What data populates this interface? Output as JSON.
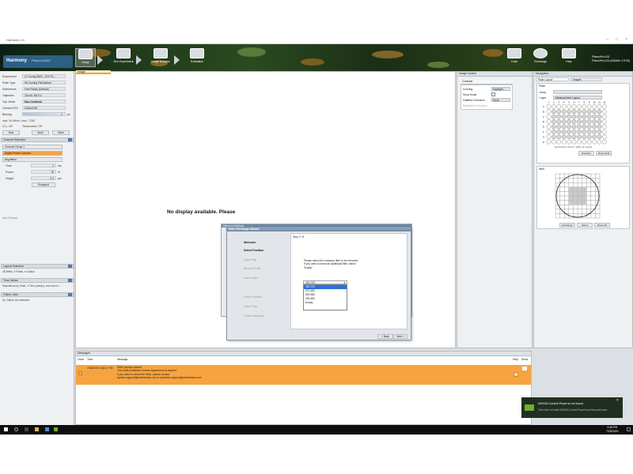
{
  "window": {
    "title": "Harmony 4.9"
  },
  "banner": {
    "logo_text": "Harmony",
    "logo_sub": "PhenoLOGIC",
    "tools": [
      {
        "label": "Setup"
      },
      {
        "label": "Run Experiment"
      },
      {
        "label": "Image Analysis"
      },
      {
        "label": "Evaluation"
      }
    ],
    "right_tools": [
      {
        "label": "Data"
      },
      {
        "label": "Exchange"
      },
      {
        "label": "Help"
      }
    ],
    "user_lines": [
      "PhenixPro123",
      "PhenixPro123 (ADMIN: 2.5TB)"
    ]
  },
  "left": {
    "fields": [
      {
        "key": "Experiment",
        "value": "LF Cornig 3603 - 20X P1..."
      },
      {
        "key": "Plate Type",
        "value": "96 Corning Flat Bottom"
      },
      {
        "key": "Subfluence",
        "value": "Fine Plastic (Default)"
      },
      {
        "key": "Objective",
        "value": "20x Air, NA 0.4"
      },
      {
        "key": "Opt. Mode",
        "value": "Non-Confocal"
      },
      {
        "key": "Camera ROI",
        "value": "2160x2160"
      },
      {
        "key": "Binning",
        "value": "2"
      }
    ],
    "binning_unit": "px",
    "measurement": "max: 3h 26min / max: 7,258",
    "co2": "CO₂: Off",
    "temperature": "Temperature: Off",
    "buttons": [
      "New",
      "Save",
      "Save"
    ],
    "channel_section": "Channel Selection",
    "channel_group": "Channel Group 1",
    "channel_active": "Digital Phase Contrast",
    "channel_bf": "Brightfield",
    "params": [
      {
        "key": "Time",
        "value": "1",
        "unit": "ms"
      },
      {
        "key": "Power",
        "value": "76",
        "unit": "%"
      },
      {
        "key": "Height",
        "value": "-2.0",
        "unit": "µm"
      }
    ],
    "snapshot_label": "Snapshot",
    "add_channel": "Add Channel",
    "layout_section": "Layout Selection",
    "layout_text": "48 Wells, 9 Fields, no Stack",
    "timeseries_section": "Time Series",
    "timeseries_text": "Repetitions by Plate, 1 Time point(s), not used in ...",
    "online_section": "Online Jobs",
    "online_text": "No Online Job selected"
  },
  "center": {
    "tab": "Image",
    "no_display": "No display available. Please"
  },
  "control": {
    "title": "Image Control",
    "section": "Contrast",
    "rows": [
      {
        "key": "Coloring",
        "value": "Highlight"
      },
      {
        "key": "Show Scale",
        "value": ""
      },
      {
        "key": "Flatfield Correction",
        "value": "None"
      },
      {
        "key": "Brightfield Correction",
        "value": ""
      }
    ]
  },
  "nav": {
    "title": "Navigation",
    "tabs": [
      "Plate Layout",
      "Images"
    ],
    "plate_header": "Plate",
    "array_label": "Array",
    "layer_label": "Layer",
    "layer_value": "Measurement Layout",
    "restrictions": "Restrictions above: 3000 µm height",
    "well_header": "Well",
    "plate_buttons": [
      "Deselect",
      "Reset Well"
    ],
    "well_buttons": [
      "Exchange",
      "Select",
      "Reset All"
    ],
    "rows": [
      "A",
      "B",
      "C",
      "D",
      "E",
      "F",
      "G",
      "H"
    ],
    "cols": [
      "1",
      "2",
      "3",
      "4",
      "5",
      "6",
      "7",
      "8",
      "9",
      "10",
      "11",
      "12"
    ]
  },
  "messages": {
    "title": "Messages",
    "headers": [
      "Level",
      "Time",
      "Message"
    ],
    "headers_right": [
      "Help",
      "Show"
    ],
    "row": {
      "time": "7/28/2020 3:48:17 PM",
      "lines": [
        "SMA License expired.",
        "Your SMA (Software License Agreement) is expired.",
        "If you want to renew the SMA, please contact",
        "",
        "sywsm.support@perkinelmer.com or sywsmto.support@perkinelmer.com"
      ]
    }
  },
  "dialog_back": {
    "title": "Harmony Settings"
  },
  "dialog": {
    "title": "Filter Exchange Wizard",
    "steps": [
      {
        "label": "Welcome",
        "current": true
      },
      {
        "label": "Select Position",
        "current": true
      },
      {
        "label": "Open Flap",
        "current": false
      },
      {
        "label": "Remove Filter",
        "current": false
      },
      {
        "label": "Insert Filter",
        "current": false
      },
      {
        "label": "Check Position",
        "current": false
      },
      {
        "label": "Close Flap",
        "current": false
      },
      {
        "label": "Finish Exchange",
        "current": false
      }
    ],
    "step_label": "Step 2 / 8",
    "instruction": [
      "Please select the emission filter to be removed.",
      "If you want to insert an additional filter, select",
      "'Empty'."
    ],
    "dropdown_value": "400-700",
    "options": [
      "400-700",
      "570-630",
      "500-550",
      "430-500",
      "Empty"
    ],
    "back": "< Back",
    "next": "Next >"
  },
  "toast": {
    "title": "NVIDIA Control Panel is not found",
    "body": "Click here to install NVIDIA Control Panel from Microsoft store."
  },
  "taskbar": {
    "time": "3:48 PM",
    "date": "7/28/2020"
  },
  "colors": {
    "accent": "#f7a33f",
    "selection": "#2d6fd6",
    "header_blue": "#6e8aa7"
  }
}
